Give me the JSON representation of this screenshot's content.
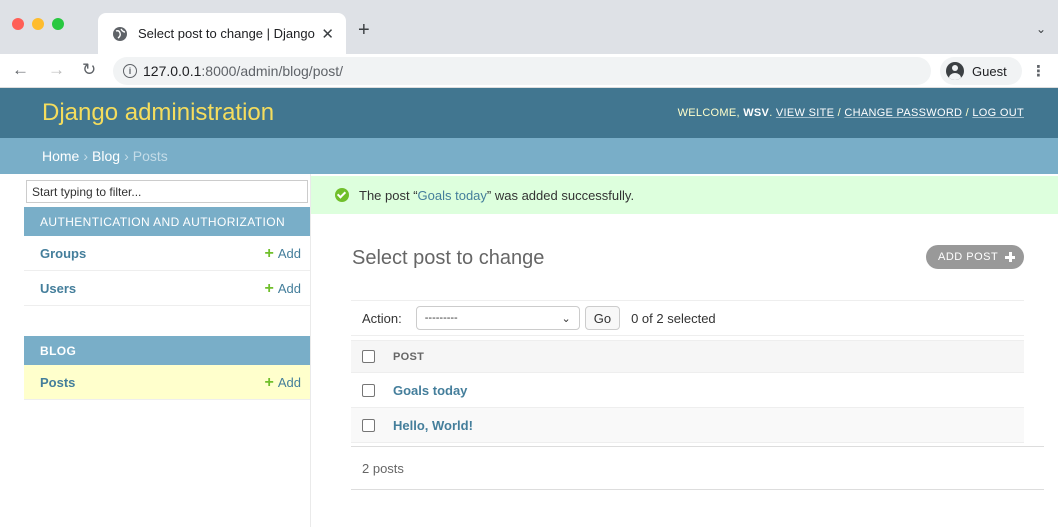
{
  "browser": {
    "tab_title": "Select post to change | Django",
    "url_host": "127.0.0.1",
    "url_rest": ":8000/admin/blog/post/",
    "profile_name": "Guest"
  },
  "header": {
    "branding": "Django administration",
    "welcome": "WELCOME,",
    "username": "WSV",
    "view_site": "VIEW SITE",
    "change_password": "CHANGE PASSWORD",
    "log_out": "LOG OUT",
    "separator": "/"
  },
  "breadcrumbs": {
    "home": "Home",
    "blog": "Blog",
    "current": "Posts",
    "arrow": "›"
  },
  "sidebar": {
    "filter_placeholder": "Start typing to filter...",
    "auth_caption": "AUTHENTICATION AND AUTHORIZATION",
    "groups": "Groups",
    "users": "Users",
    "blog_caption": "BLOG",
    "posts": "Posts",
    "add_label": "Add"
  },
  "message": {
    "prefix": "The post “",
    "link": "Goals today",
    "suffix": "” was added successfully."
  },
  "content": {
    "title": "Select post to change",
    "add_button": "ADD POST",
    "action_label": "Action:",
    "action_value": "---------",
    "go_button": "Go",
    "selected_count": "0 of 2 selected",
    "column_header": "POST",
    "rows": [
      "Goals today",
      "Hello, World!"
    ],
    "paginator": "2 posts"
  },
  "colors": {
    "header_bg": "#417690",
    "branding": "#f5dd5d",
    "breadcrumb_bg": "#79aec8",
    "success_bg": "#ddffdd",
    "link": "#447e9b",
    "add_green": "#70bf2b",
    "active_row": "#ffffcc"
  }
}
